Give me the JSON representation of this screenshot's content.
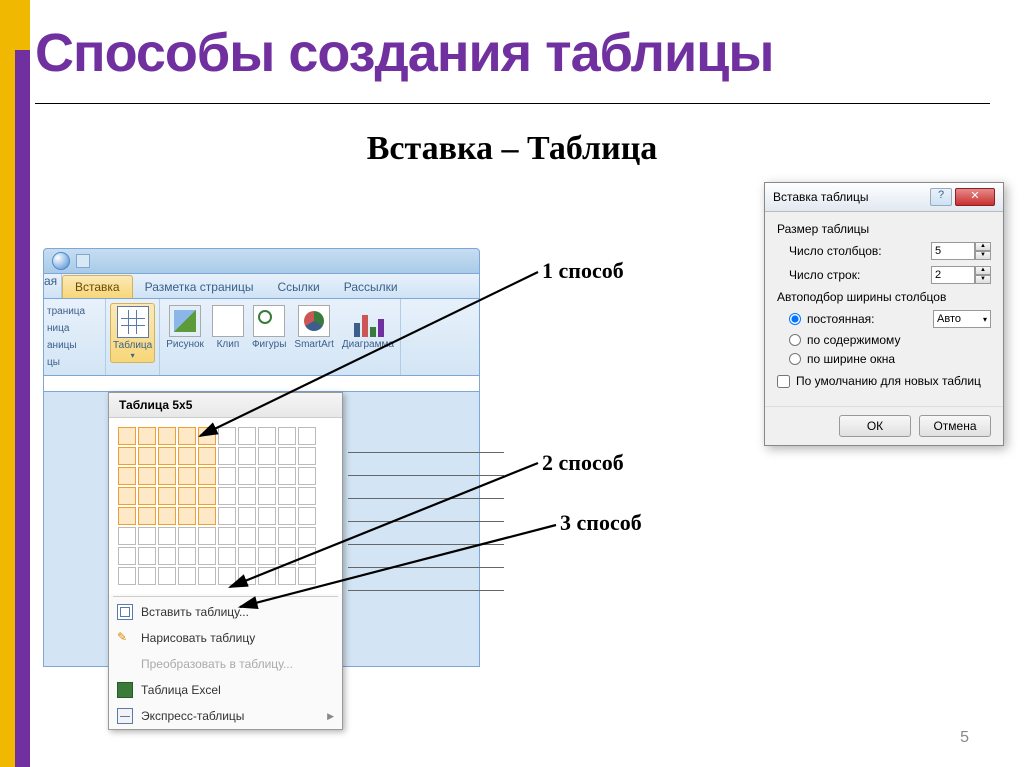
{
  "slide": {
    "title": "Способы создания таблицы",
    "subtitle": "Вставка – Таблица",
    "page_number": "5"
  },
  "annotations": {
    "method1": "1 способ",
    "method2": "2 способ",
    "method3": "3 способ"
  },
  "ribbon": {
    "tabs_cut": "ая",
    "tabs": [
      "Вставка",
      "Разметка страницы",
      "Ссылки",
      "Рассылки"
    ],
    "active_tab": "Вставка",
    "left_group_cut": [
      "траница",
      "ница",
      "аницы",
      "цы"
    ],
    "buttons": {
      "table": "Таблица",
      "picture": "Рисунок",
      "clip": "Клип",
      "shapes": "Фигуры",
      "smartart": "SmartArt",
      "chart": "Диаграмма"
    }
  },
  "table_dropdown": {
    "header": "Таблица 5x5",
    "grid": {
      "rows": 8,
      "cols": 10,
      "sel_rows": 5,
      "sel_cols": 5
    },
    "items": [
      {
        "label": "Вставить таблицу...",
        "icon": "mi-insert",
        "disabled": false
      },
      {
        "label": "Нарисовать таблицу",
        "icon": "mi-draw",
        "disabled": false
      },
      {
        "label": "Преобразовать в таблицу...",
        "icon": "",
        "disabled": true
      },
      {
        "label": "Таблица Excel",
        "icon": "mi-excel",
        "disabled": false
      },
      {
        "label": "Экспресс-таблицы",
        "icon": "mi-express",
        "disabled": false,
        "arrow": true
      }
    ]
  },
  "dialog": {
    "title": "Вставка таблицы",
    "section_size": "Размер таблицы",
    "label_cols": "Число столбцов:",
    "value_cols": "5",
    "label_rows": "Число строк:",
    "value_rows": "2",
    "section_autofit": "Автоподбор ширины столбцов",
    "radio_fixed": "постоянная:",
    "radio_fixed_value": "Авто",
    "radio_content": "по содержимому",
    "radio_window": "по ширине окна",
    "checkbox_default": "По умолчанию для новых таблиц",
    "btn_ok": "ОК",
    "btn_cancel": "Отмена"
  }
}
